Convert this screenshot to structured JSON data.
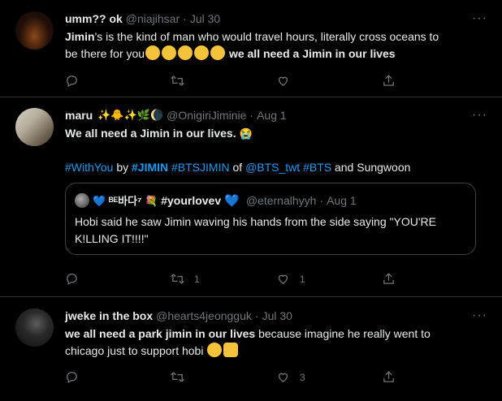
{
  "tweets": [
    {
      "name": "umm?? ok",
      "handle": "@niajihsar",
      "date": "Jul 30",
      "more": "···",
      "text_line1_part1": "Jimin",
      "text_line1_part2": "'s is the kind of man who would travel hours, literally cross oceans to",
      "text_line2_part1": "be there for you",
      "text_line2_part2": " we all need a Jimin in our lives",
      "emoji": "relieved-face",
      "emoji_count": 5,
      "reply_count": "",
      "retweet_count": "",
      "like_count": ""
    },
    {
      "name": "maru",
      "name_emojis": "✨🐥✨🌿🌘",
      "handle": "@OnigiriJiminie",
      "date": "Aug 1",
      "more": "···",
      "text_line1": "We all need a Jimin in our lives.",
      "text_line1_emoji": "😭",
      "tag1": "#WithYou",
      "by": "by",
      "tag2": "#JIMIN",
      "tag3": "#BTSJIMIN",
      "of": "of",
      "mention": "@BTS_twt",
      "tag4": "#BTS",
      "and_text": "and Sungwoon",
      "quote": {
        "name_prefix": "💙 ᴮᴱ바다⁷ 💐",
        "name_tag": "#yourlovev",
        "name_suffix": "💙",
        "handle": "@eternalhyyh",
        "date": "Aug 1",
        "text_line1": "Hobi said he saw Jimin waving his hands from the side saying \"YOU'RE",
        "text_line2": "K!LLING IT!!!!\""
      },
      "reply_count": "",
      "retweet_count": "1",
      "like_count": "1"
    },
    {
      "name": "jweke in the box",
      "handle": "@hearts4jeongguk",
      "date": "Jul 30",
      "more": "···",
      "text_line1_part1": "we all need a park ",
      "text_line1_part2": "jimin in our lives",
      "text_line1_part3": " because imagine he really went to",
      "text_line2": "chicago just to support hobi",
      "reply_count": "",
      "retweet_count": "",
      "like_count": "3"
    }
  ],
  "colors": {
    "background": "#000000",
    "text": "#e7e9ea",
    "muted": "#71767b",
    "link": "#1d9bf0",
    "border": "#2f3336"
  },
  "icons": [
    "reply-icon",
    "retweet-icon",
    "like-icon",
    "share-icon",
    "more-icon"
  ]
}
